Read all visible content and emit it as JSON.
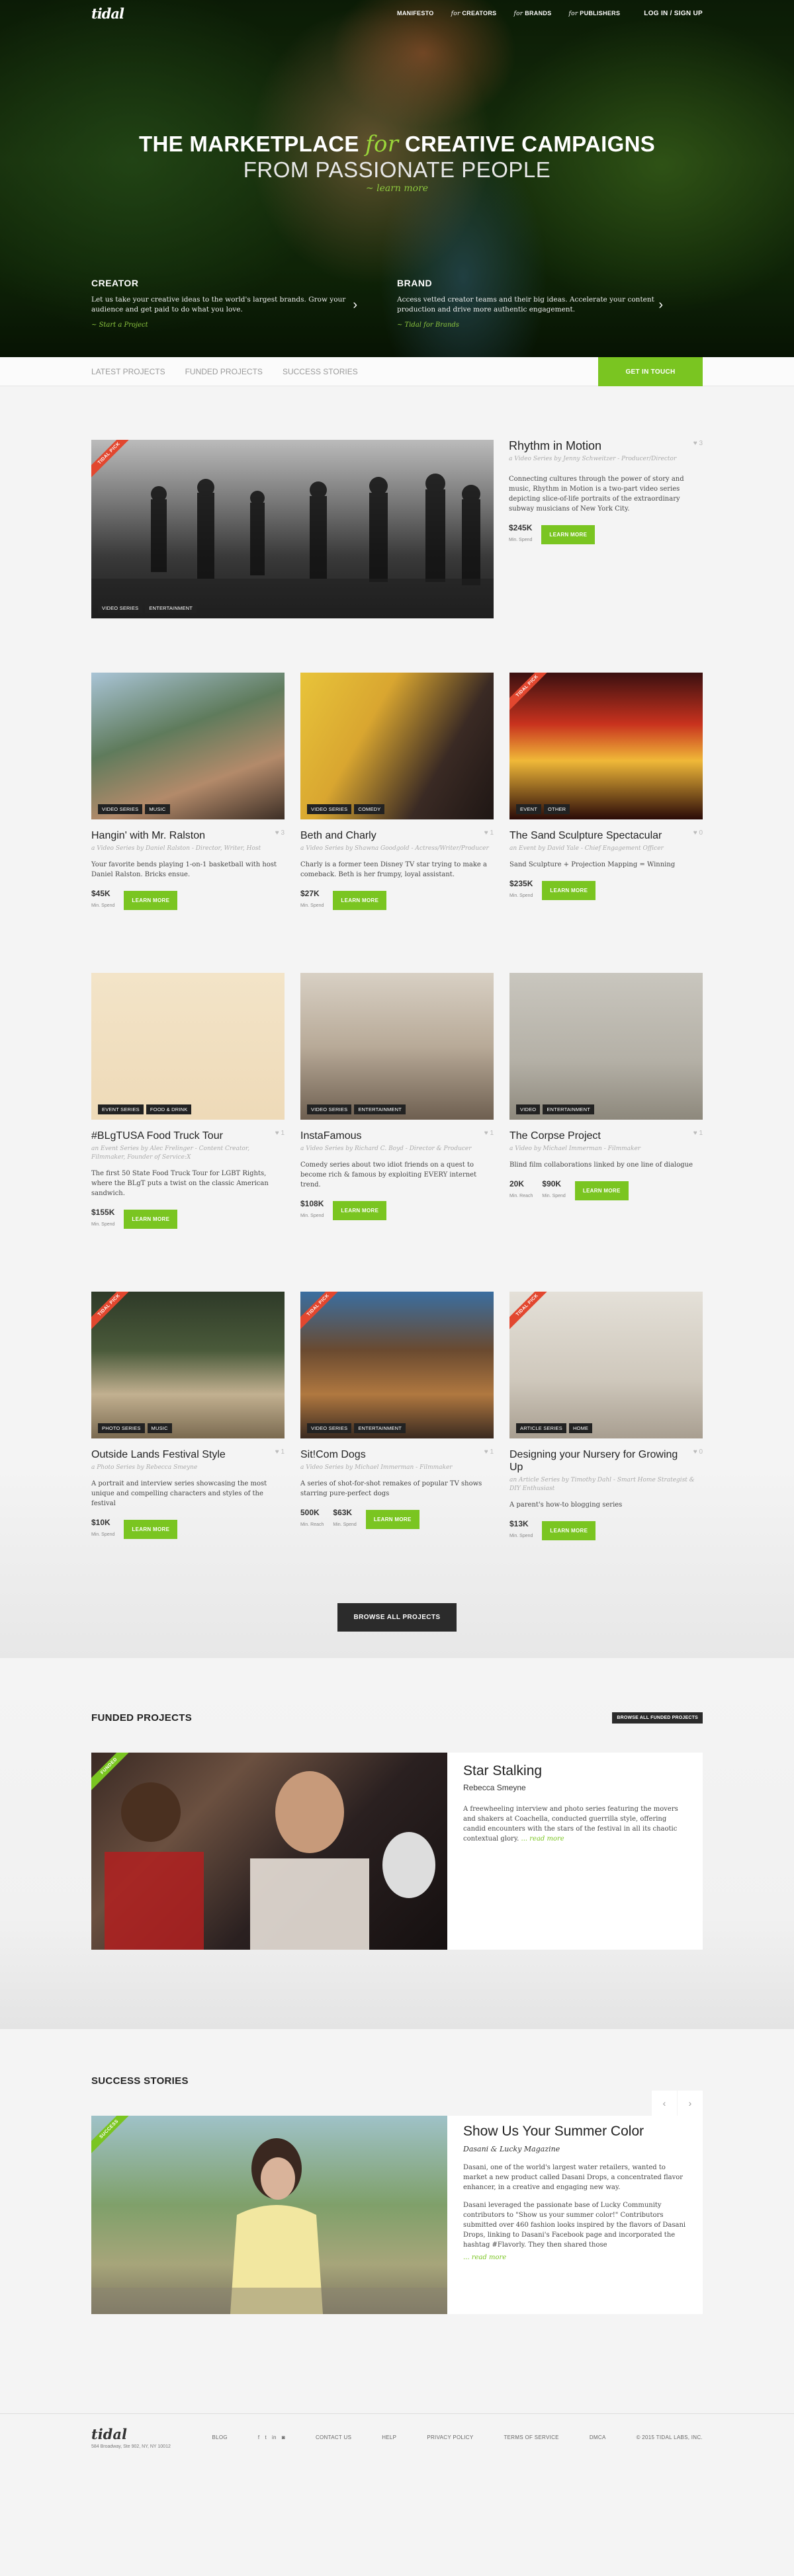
{
  "nav": {
    "logo": "tidal",
    "manifesto": "MANIFESTO",
    "for_creators_pre": "for",
    "for_creators": "CREATORS",
    "for_brands_pre": "for",
    "for_brands": "BRANDS",
    "for_publishers_pre": "for",
    "for_publishers": "PUBLISHERS",
    "login": "LOG IN / SIGN UP"
  },
  "hero": {
    "title_a": "THE MARKETPLACE",
    "title_for": "for",
    "title_b": "CREATIVE CAMPAIGNS",
    "subtitle": "FROM PASSIONATE PEOPLE",
    "learn_more": "~ learn more",
    "creator": {
      "title": "CREATOR",
      "text": "Let us take your creative ideas to the world's largest brands. Grow your audience and get paid to do what you love.",
      "link": "~ Start a Project"
    },
    "brand": {
      "title": "BRAND",
      "text": "Access vetted creator teams and their big ideas. Accelerate your content production and drive more authentic engagement.",
      "link": "~ Tidal for Brands"
    }
  },
  "subnav": {
    "tabs": [
      "LATEST PROJECTS",
      "FUNDED PROJECTS",
      "SUCCESS STORIES"
    ],
    "cta": "GET IN TOUCH"
  },
  "featured": {
    "ribbon": "TIDAL PICK",
    "title": "Rhythm in Motion",
    "subtitle": "a Video Series by Jenny Schweitzer - Producer/Director",
    "desc": "Connecting cultures through the power of story and music, Rhythm in Motion is a two-part video series depicting slice-of-life portraits of the extraordinary subway musicians of New York City.",
    "stat_val": "$245K",
    "stat_lbl": "Min. Spend",
    "btn": "LEARN MORE",
    "tags": [
      "VIDEO SERIES",
      "ENTERTAINMENT"
    ],
    "likes": "3"
  },
  "cards": [
    {
      "ribbon": "",
      "title": "Hangin' with Mr. Ralston",
      "subtitle": "a Video Series by Daniel Ralston - Director, Writer, Host",
      "desc": "Your favorite bends playing 1-on-1 basketball with host Daniel Ralston. Bricks ensue.",
      "stats": [
        {
          "v": "$45K",
          "l": "Min. Spend"
        }
      ],
      "btn": "LEARN MORE",
      "tags": [
        "VIDEO SERIES",
        "MUSIC"
      ],
      "likes": "3"
    },
    {
      "ribbon": "",
      "title": "Beth and Charly",
      "subtitle": "a Video Series by Shawna Goodgold - Actress/Writer/Producer",
      "desc": "Charly is a former teen Disney TV star trying to make a comeback. Beth is her frumpy, loyal assistant.",
      "stats": [
        {
          "v": "$27K",
          "l": "Min. Spend"
        }
      ],
      "btn": "LEARN MORE",
      "tags": [
        "VIDEO SERIES",
        "COMEDY"
      ],
      "likes": "1"
    },
    {
      "ribbon": "TIDAL PICK",
      "title": "The Sand Sculpture Spectacular",
      "subtitle": "an Event by David Yale - Chief Engagement Officer",
      "desc": "Sand Sculpture + Projection Mapping = Winning",
      "stats": [
        {
          "v": "$235K",
          "l": "Min. Spend"
        }
      ],
      "btn": "LEARN MORE",
      "tags": [
        "EVENT",
        "OTHER"
      ],
      "likes": "0"
    },
    {
      "ribbon": "",
      "title": "#BLgTUSA Food Truck Tour",
      "subtitle": "an Event Series by Alec Frelinger - Content Creator, Filmmaker, Founder of Service:X",
      "desc": "The first 50 State Food Truck Tour for LGBT Rights, where the BLgT puts a twist on the classic American sandwich.",
      "stats": [
        {
          "v": "$155K",
          "l": "Min. Spend"
        }
      ],
      "btn": "LEARN MORE",
      "tags": [
        "EVENT SERIES",
        "FOOD & DRINK"
      ],
      "likes": "1"
    },
    {
      "ribbon": "",
      "title": "InstaFamous",
      "subtitle": "a Video Series by Richard C. Boyd - Director & Producer",
      "desc": "Comedy series about two idiot friends on a quest to become rich & famous by exploiting EVERY internet trend.",
      "stats": [
        {
          "v": "$108K",
          "l": "Min. Spend"
        }
      ],
      "btn": "LEARN MORE",
      "tags": [
        "VIDEO SERIES",
        "ENTERTAINMENT"
      ],
      "likes": "1"
    },
    {
      "ribbon": "",
      "title": "The Corpse Project",
      "subtitle": "a Video by Michael Immerman - Filmmaker",
      "desc": "Blind film collaborations linked by one line of dialogue",
      "stats": [
        {
          "v": "20K",
          "l": "Min. Reach"
        },
        {
          "v": "$90K",
          "l": "Min. Spend"
        }
      ],
      "btn": "LEARN MORE",
      "tags": [
        "VIDEO",
        "ENTERTAINMENT"
      ],
      "likes": "1"
    },
    {
      "ribbon": "TIDAL PICK",
      "title": "Outside Lands Festival Style",
      "subtitle": "a Photo Series by Rebecca Smeyne",
      "desc": "A portrait and interview series showcasing the most unique and compelling characters and styles of the festival",
      "stats": [
        {
          "v": "$10K",
          "l": "Min. Spend"
        }
      ],
      "btn": "LEARN MORE",
      "tags": [
        "PHOTO SERIES",
        "MUSIC"
      ],
      "likes": "1"
    },
    {
      "ribbon": "TIDAL PICK",
      "title": "Sit!Com Dogs",
      "subtitle": "a Video Series by Michael Immerman - Filmmaker",
      "desc": "A series of shot-for-shot remakes of popular TV shows starring pure-perfect dogs",
      "stats": [
        {
          "v": "500K",
          "l": "Min. Reach"
        },
        {
          "v": "$63K",
          "l": "Min. Spend"
        }
      ],
      "btn": "LEARN MORE",
      "tags": [
        "VIDEO SERIES",
        "ENTERTAINMENT"
      ],
      "likes": "1"
    },
    {
      "ribbon": "TIDAL PICK",
      "title": "Designing your Nursery for Growing Up",
      "subtitle": "an Article Series by Timothy Dahl - Smart Home Strategist & DIY Enthusiast",
      "desc": "A parent's how-to blogging series",
      "stats": [
        {
          "v": "$13K",
          "l": "Min. Spend"
        }
      ],
      "btn": "LEARN MORE",
      "tags": [
        "ARTICLE SERIES",
        "HOME"
      ],
      "likes": "0"
    }
  ],
  "browse": "BROWSE ALL PROJECTS",
  "funded": {
    "heading": "FUNDED PROJECTS",
    "btn": "BROWSE ALL FUNDED PROJECTS",
    "ribbon": "FUNDED",
    "title": "Star Stalking",
    "by": "Rebecca Smeyne",
    "desc": "A freewheeling interview and photo series featuring the movers and shakers at Coachella, conducted guerrilla style, offering candid encounters with the stars of the festival in all its chaotic contextual glory.",
    "more": "... read more"
  },
  "success": {
    "heading": "SUCCESS STORIES",
    "prev": "‹",
    "next": "›",
    "ribbon": "SUCCESS",
    "title": "Show Us Your Summer Color",
    "by": "Dasani & Lucky Magazine",
    "p1": "Dasani, one of the world's largest water retailers, wanted to market a new product called Dasani Drops, a concentrated flavor enhancer, in a creative and engaging new way.",
    "p2": "Dasani leveraged the passionate base of Lucky Community contributors to \"Show us your summer color!\" Contributors submitted over 460 fashion looks inspired by the flavors of Dasani Drops, linking to Dasani's Facebook page and incorporated the hashtag #Flavorly. They then shared those",
    "more": "... read more"
  },
  "footer": {
    "logo": "tidal",
    "address": "584 Broadway, Ste 902, NY, NY 10012",
    "links": [
      "BLOG",
      "CONTACT US",
      "HELP",
      "PRIVACY POLICY",
      "TERMS OF SERVICE",
      "DMCA"
    ],
    "social": [
      "f",
      "t",
      "in",
      "◙"
    ],
    "copyright": "© 2015 TIDAL LABS, INC."
  }
}
